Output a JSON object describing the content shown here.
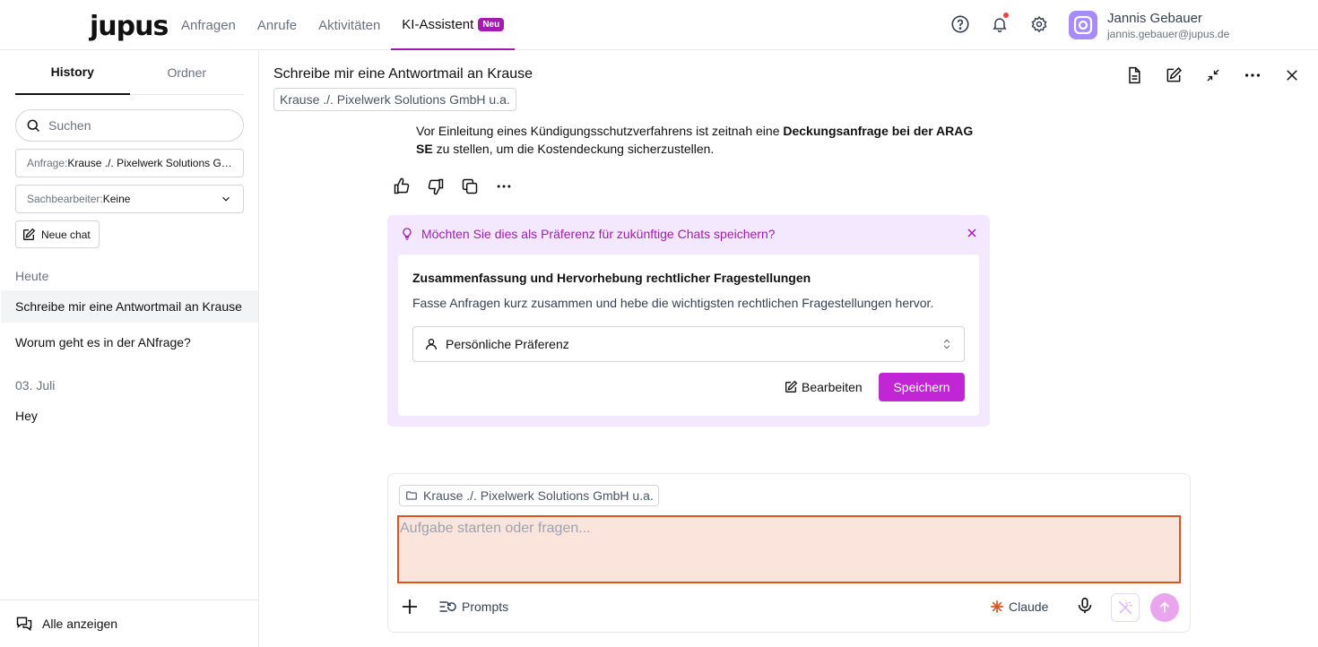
{
  "app": {
    "logo": "jupus",
    "nav": [
      {
        "label": "Anfragen"
      },
      {
        "label": "Anrufe"
      },
      {
        "label": "Aktivitäten"
      },
      {
        "label": "KI-Assistent",
        "badge": "Neu",
        "active": true
      }
    ],
    "user": {
      "name": "Jannis Gebauer",
      "email": "jannis.gebauer@jupus.de"
    },
    "icons": [
      "help-icon",
      "bell-icon",
      "settings-icon"
    ],
    "accent": "#a21caf"
  },
  "sidebar": {
    "tabs": [
      "History",
      "Ordner"
    ],
    "search_placeholder": "Suchen",
    "filter_anfrage": {
      "label": "Anfrage:",
      "value": "Krause ./. Pixelwerk Solutions GmbH u.a."
    },
    "filter_sachbearbeiter": {
      "label": "Sachbearbeiter:",
      "value": "Keine"
    },
    "new_chat": "Neue chat",
    "groups": [
      {
        "label": "Heute",
        "items": [
          "Schreibe mir eine Antwortmail an Krause",
          "Worum geht es in der ANfrage?"
        ]
      },
      {
        "label": "03. Juli",
        "items": [
          "Hey"
        ]
      }
    ],
    "footer": "Alle anzeigen"
  },
  "chat": {
    "title": "Schreibe mir eine Antwortmail an Krause",
    "case_chip": "Krause ./. Pixelwerk Solutions GmbH u.a.",
    "message": {
      "before": "Vor Einleitung eines Kündigungsschutzverfahrens ist zeitnah eine ",
      "bold": "Deckungsanfrage bei der ARAG SE",
      "after": " zu stellen, um die Kostendeckung sicherzustellen."
    },
    "preference": {
      "question": "Möchten Sie dies als Präferenz für zukünftige Chats speichern?",
      "title": "Zusammenfassung und Hervorhebung rechtlicher Fragestellungen",
      "description": "Fasse Anfragen kurz zusammen und hebe die wichtigsten rechtlichen Fragestellungen hervor.",
      "scope": "Persönliche Präferenz",
      "edit": "Bearbeiten",
      "save": "Speichern"
    },
    "composer": {
      "case_chip": "Krause ./. Pixelwerk Solutions GmbH u.a.",
      "placeholder": "Aufgabe starten oder fragen...",
      "prompts": "Prompts",
      "model": "Claude"
    }
  }
}
